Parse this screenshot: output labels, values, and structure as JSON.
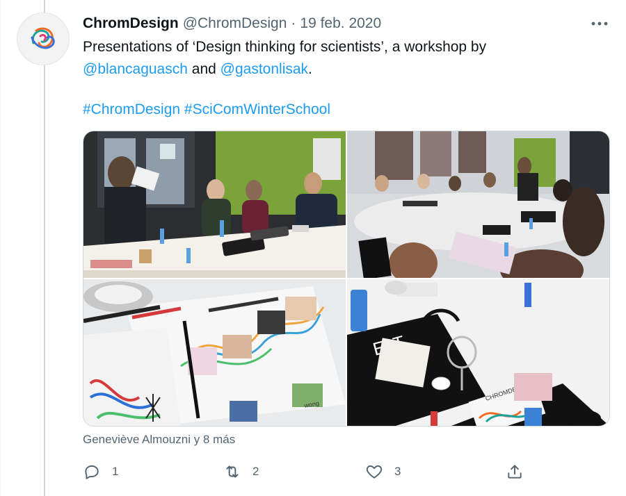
{
  "tweet": {
    "author_name": "ChromDesign",
    "author_handle": "@ChromDesign",
    "separator": "·",
    "date": "19 feb. 2020",
    "text_before": "Presentations of ‘Design thinking for scientists’, a workshop by",
    "mention_1": "@blancaguasch",
    "text_and": "and",
    "mention_2": "@gastonlisak",
    "text_end": ".",
    "hashtag_1": "#ChromDesign",
    "hashtag_2": "#SciComWinterSchool"
  },
  "media": {
    "photos": [
      {
        "name": "photo-presenter-at-table"
      },
      {
        "name": "photo-room-overview"
      },
      {
        "name": "photo-design-sheets"
      },
      {
        "name": "photo-table-with-bags"
      }
    ],
    "photo_text": {
      "tote_label": "ELT",
      "card_label": "CHROMDESIGN",
      "sheet_word": "wong"
    }
  },
  "liked_by": "Geneviève Almouzni y 8 más",
  "actions": {
    "reply_count": "1",
    "retweet_count": "2",
    "like_count": "3"
  },
  "icons": [
    "chromdesign-logo-icon",
    "more-icon",
    "reply-icon",
    "retweet-icon",
    "like-icon",
    "share-icon"
  ],
  "colors": {
    "link": "#1d9bf0",
    "muted_text": "#536471",
    "wall_green": "#7aa33a",
    "logo_teal": "#1aa39a",
    "logo_orange": "#f26b21",
    "logo_blue": "#3b6fd8"
  }
}
